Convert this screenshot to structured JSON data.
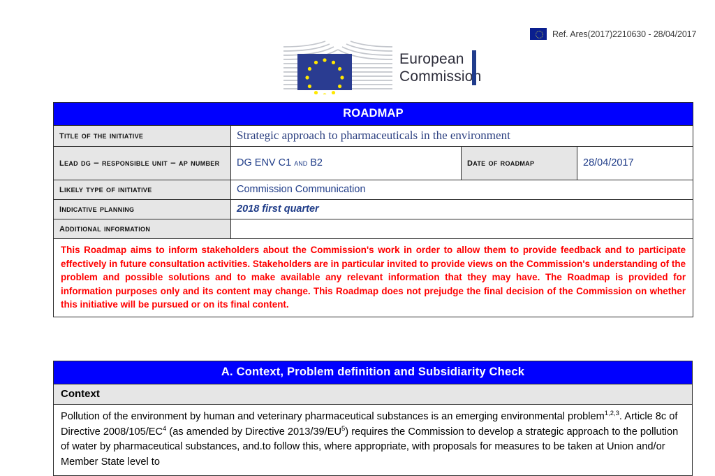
{
  "ares_stamp": {
    "icon": "eu-flag-icon",
    "text": "Ref. Ares(2017)2210630 - 28/04/2017"
  },
  "logo": {
    "icon": "european-commission-logo",
    "line1": "European",
    "line2": "Commission"
  },
  "roadmap": {
    "banner": "ROADMAP",
    "rows": {
      "title": {
        "label": "Title of the initiative",
        "value": "Strategic approach to pharmaceuticals in the environment"
      },
      "lead_dg": {
        "label": "Lead DG – responsible unit – AP Number",
        "value_pre": "DG ENV C1 ",
        "value_sc": "and",
        "value_post": " B2"
      },
      "date": {
        "label": "Date of roadmap",
        "value": "28/04/2017"
      },
      "likely_type": {
        "label": "Likely Type of initiative",
        "value": "Commission Communication"
      },
      "indicative_planning": {
        "label": "Indicative Planning",
        "value": "2018 first quarter"
      },
      "additional_information": {
        "label": "Additional Information",
        "value": ""
      }
    },
    "disclaimer": "This Roadmap aims to inform stakeholders about the Commission's work in order to allow them to provide feedback and to participate effectively in future consultation activities. Stakeholders are in particular invited to provide views on the Commission's understanding of the problem and possible solutions and to make available any relevant information that they may have. The Roadmap is provided for information purposes only and its content may change. This Roadmap does not prejudge the final decision of the Commission on whether this initiative will be pursued or on its final content."
  },
  "section_a": {
    "banner": "A. Context, Problem definition and Subsidiarity Check",
    "subhead": "Context",
    "paragraph": {
      "part1": "Pollution of the environment by human and veterinary pharmaceutical substances is an emerging environmental problem",
      "sup1": "1,2,3",
      "part2": ". Article 8c of Directive 2008/105/EC",
      "sup2": "4",
      "part3": " (as amended by Directive 2013/39/EU",
      "sup3": "5",
      "part4": ") requires the Commission to develop a strategic approach to the pollution of water by pharmaceutical substances, and.to follow this, where appropriate, with proposals for measures to be taken at Union and/or Member State level to"
    }
  },
  "colors": {
    "banner_blue": "#0000ff",
    "value_blue": "#1f3c88",
    "disclaimer_red": "#ff0000",
    "label_gray": "#e6e6e6"
  }
}
